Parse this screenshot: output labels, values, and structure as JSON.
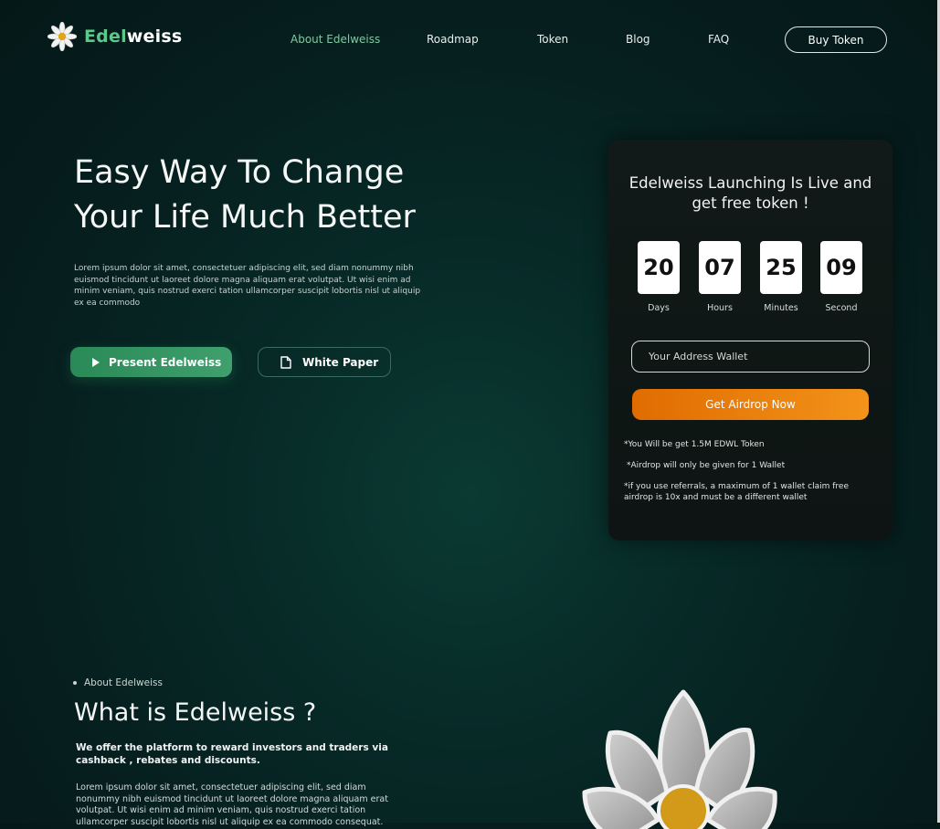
{
  "brand": {
    "part1": "Edel",
    "part2": "weiss"
  },
  "nav": {
    "links": [
      "About Edelweiss",
      "Roadmap",
      "Token",
      "Blog",
      "FAQ"
    ],
    "active": "About Edelweiss",
    "buy_label": "Buy Token"
  },
  "hero": {
    "title_line1": "Easy Way To Change",
    "title_line2": "Your Life Much Better",
    "description": "Lorem ipsum dolor sit amet, consectetuer adipiscing elit, sed diam nonummy nibh euismod tincidunt ut laoreet dolore magna aliquam erat volutpat. Ut wisi enim ad minim veniam, quis nostrud exerci tation ullamcorper suscipit lobortis nisl ut aliquip ex ea commodo",
    "present_label": "Present Edelweiss",
    "paper_label": "White Paper"
  },
  "launch": {
    "title": "Edelweiss Launching Is Live and get free token !",
    "countdown": [
      {
        "value": "20",
        "label": "Days"
      },
      {
        "value": "07",
        "label": "Hours"
      },
      {
        "value": "25",
        "label": "Minutes"
      },
      {
        "value": "09",
        "label": "Second"
      }
    ],
    "wallet_placeholder": "Your Address Wallet",
    "airdrop_label": "Get Airdrop Now",
    "notes": [
      "*You Will be get 1.5M EDWL Token",
      "*Airdrop will only be given for 1 Wallet",
      "*if you use referrals, a maximum of 1 wallet claim free airdrop is 10x and must be a different wallet"
    ]
  },
  "about": {
    "kicker": "About Edelweiss",
    "title": "What is Edelweiss ?",
    "subtitle": "We offer the platform to reward investors and traders via cashback , rebates and discounts.",
    "body": "Lorem ipsum dolor sit amet, consectetuer adipiscing elit, sed diam nonummy nibh euismod tincidunt ut laoreet dolore magna aliquam erat volutpat. Ut wisi enim ad minim veniam, quis nostrud exerci tation ullamcorper suscipit lobortis nisl ut aliquip ex ea commodo consequat."
  },
  "colors": {
    "accent_green": "#3fa06d",
    "accent_orange": "#f3931a",
    "bg": "#061f1f"
  },
  "icons": {
    "logo": "edelweiss-flower-icon",
    "present": "play-icon",
    "paper": "document-icon"
  }
}
